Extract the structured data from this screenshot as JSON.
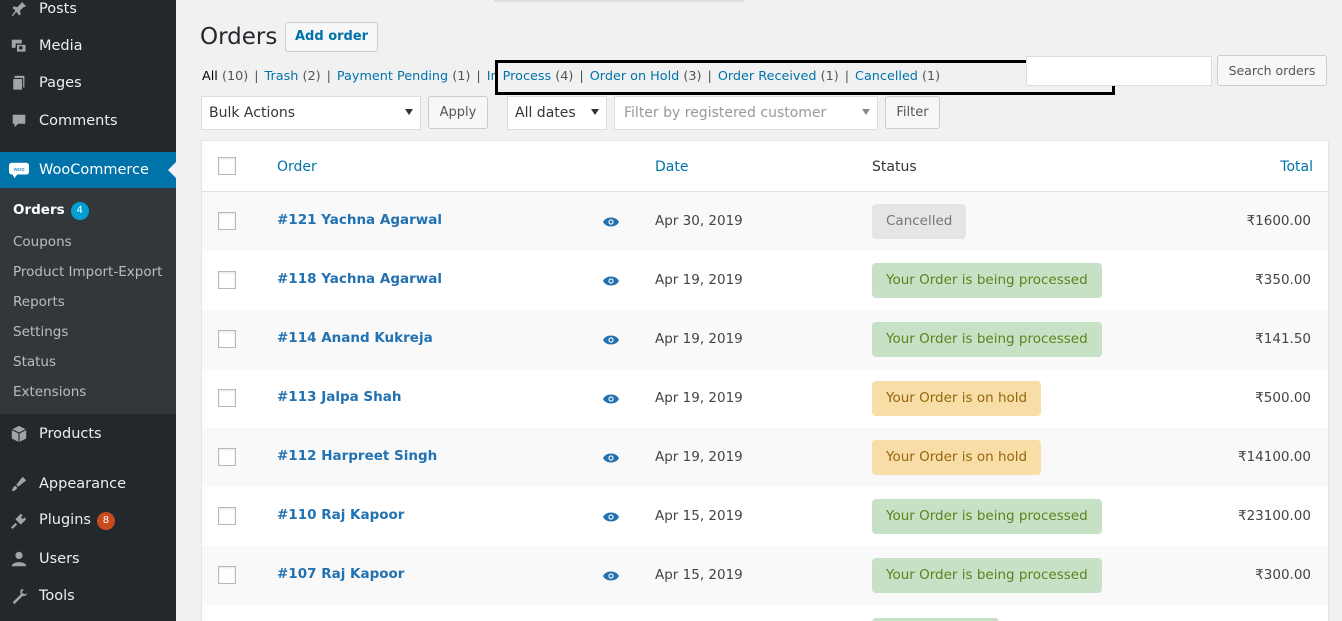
{
  "sidebar": {
    "items": [
      {
        "label": "Posts",
        "icon": "pin-icon"
      },
      {
        "label": "Media",
        "icon": "media-icon"
      },
      {
        "label": "Pages",
        "icon": "pages-icon"
      },
      {
        "label": "Comments",
        "icon": "comments-icon"
      },
      {
        "label": "WooCommerce",
        "icon": "woocommerce-icon"
      },
      {
        "label": "Products",
        "icon": "products-icon"
      },
      {
        "label": "Appearance",
        "icon": "appearance-icon"
      },
      {
        "label": "Plugins",
        "icon": "plugins-icon",
        "badge": "8"
      },
      {
        "label": "Users",
        "icon": "users-icon"
      },
      {
        "label": "Tools",
        "icon": "tools-icon"
      }
    ],
    "woo_logo_text": "woo",
    "submenu": [
      {
        "label": "Orders",
        "badge": "4"
      },
      {
        "label": "Coupons"
      },
      {
        "label": "Product Import-Export"
      },
      {
        "label": "Reports"
      },
      {
        "label": "Settings"
      },
      {
        "label": "Status"
      },
      {
        "label": "Extensions"
      }
    ]
  },
  "header": {
    "title": "Orders",
    "add_button": "Add order"
  },
  "filters_links": [
    {
      "label": "All",
      "count": "(10)"
    },
    {
      "label": "Trash",
      "count": "(2)"
    },
    {
      "label": "Payment Pending",
      "count": "(1)"
    },
    {
      "label": "In Process",
      "count": "(4)"
    },
    {
      "label": "Order on Hold",
      "count": "(3)"
    },
    {
      "label": "Order Received",
      "count": "(1)"
    },
    {
      "label": "Cancelled",
      "count": "(1)"
    }
  ],
  "search": {
    "button": "Search orders"
  },
  "toolbar": {
    "bulk_actions": "Bulk Actions",
    "apply": "Apply",
    "dates": "All dates",
    "customer_placeholder": "Filter by registered customer",
    "filter": "Filter"
  },
  "table": {
    "columns": {
      "order": "Order",
      "date": "Date",
      "status": "Status",
      "total": "Total"
    },
    "rows": [
      {
        "order": "#121 Yachna Agarwal",
        "date": "Apr 30, 2019",
        "status": "Cancelled",
        "status_type": "cancelled",
        "total": "₹1600.00"
      },
      {
        "order": "#118 Yachna Agarwal",
        "date": "Apr 19, 2019",
        "status": "Your Order is being processed",
        "status_type": "processing",
        "total": "₹350.00"
      },
      {
        "order": "#114 Anand Kukreja",
        "date": "Apr 19, 2019",
        "status": "Your Order is being processed",
        "status_type": "processing",
        "total": "₹141.50"
      },
      {
        "order": "#113 Jalpa Shah",
        "date": "Apr 19, 2019",
        "status": "Your Order is on hold",
        "status_type": "hold",
        "total": "₹500.00"
      },
      {
        "order": "#112 Harpreet Singh",
        "date": "Apr 19, 2019",
        "status": "Your Order is on hold",
        "status_type": "hold",
        "total": "₹14100.00"
      },
      {
        "order": "#110 Raj Kapoor",
        "date": "Apr 15, 2019",
        "status": "Your Order is being processed",
        "status_type": "processing",
        "total": "₹23100.00"
      },
      {
        "order": "#107 Raj Kapoor",
        "date": "Apr 15, 2019",
        "status": "Your Order is being processed",
        "status_type": "processing",
        "total": "₹300.00"
      }
    ]
  },
  "colors": {
    "sidebar_bg": "#23282d",
    "active_bg": "#0073aa",
    "link": "#0073aa",
    "processing_bg": "#c6e1c6",
    "hold_bg": "#f8dda7",
    "cancelled_bg": "#e5e5e5"
  }
}
